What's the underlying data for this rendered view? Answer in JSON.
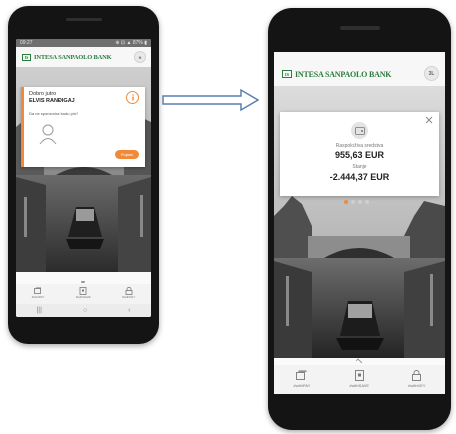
{
  "left_phone": {
    "status": {
      "time": "09:27",
      "right": "⊕ ⊡ ▲ 87% ▮"
    },
    "bank_name": "INTESA SANPAOLO BANK",
    "avatar_initial": "ft",
    "card": {
      "greeting": "Dobro jutro",
      "user_name": "ELVIS RANĐIGAJ",
      "question": "Da ne sponzorira budu pin?",
      "button_label": "Pojami"
    },
    "nav": [
      {
        "label": "#withPAY"
      },
      {
        "label": "#withSAVE"
      },
      {
        "label": "#withKEY"
      }
    ]
  },
  "right_phone": {
    "bank_name": "INTESA SANPAOLO BANK",
    "avatar_initial": "3L",
    "balance_card": {
      "available_label": "Raspoloživa sredstva",
      "available_value": "955,63 EUR",
      "balance_label": "Stanje",
      "balance_value": "-2.444,37 EUR"
    },
    "nav": [
      {
        "label": "#withPAY"
      },
      {
        "label": "#withSAVE"
      },
      {
        "label": "#withKEY"
      }
    ]
  },
  "colors": {
    "brand_green": "#2a7d3f",
    "accent_orange": "#f08a3a",
    "nav_bg": "#f3f3f3"
  }
}
